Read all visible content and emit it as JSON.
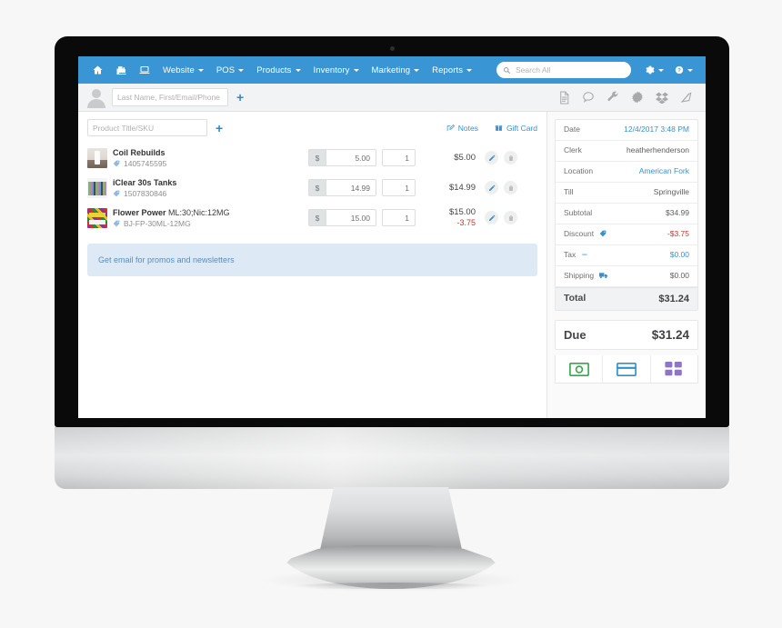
{
  "topnav": {
    "icons": [
      {
        "name": "home-icon"
      },
      {
        "name": "cash-register-icon"
      },
      {
        "name": "laptop-icon"
      }
    ],
    "menus": [
      {
        "label": "Website"
      },
      {
        "label": "POS"
      },
      {
        "label": "Products"
      },
      {
        "label": "Inventory"
      },
      {
        "label": "Marketing"
      },
      {
        "label": "Reports"
      }
    ],
    "search_placeholder": "Search All",
    "right_menus": [
      {
        "name": "settings-menu",
        "icon": "gear-icon"
      },
      {
        "name": "help-menu",
        "icon": "question-circle-icon"
      }
    ],
    "bg_color": "#3a95d4"
  },
  "customer_bar": {
    "avatar": "avatar-placeholder",
    "search_placeholder": "Last Name, First/Email/Phone",
    "add_label": "+",
    "tools": [
      {
        "name": "document-icon"
      },
      {
        "name": "comment-icon"
      },
      {
        "name": "wrench-icon"
      },
      {
        "name": "burst-gear-icon"
      },
      {
        "name": "dropbox-icon"
      },
      {
        "name": "tag-icon"
      }
    ]
  },
  "order": {
    "product_search_placeholder": "Product Title/SKU",
    "add_label": "+",
    "notes_label": "Notes",
    "gift_card_label": "Gift Card",
    "currency_symbol": "$",
    "items": [
      {
        "name": "Coil Rebuilds",
        "variant": "",
        "sku": "1405745595",
        "price": "5.00",
        "qty": "1",
        "total": "$5.00",
        "discount": ""
      },
      {
        "name": "iClear 30s Tanks",
        "variant": "",
        "sku": "1507830846",
        "price": "14.99",
        "qty": "1",
        "total": "$14.99",
        "discount": ""
      },
      {
        "name": "Flower Power",
        "variant": "ML:30;Nic:12MG",
        "sku": "BJ-FP-30ML-12MG",
        "price": "15.00",
        "qty": "1",
        "total": "$15.00",
        "discount": "-3.75"
      }
    ],
    "promo_text": "Get email for promos and newsletters"
  },
  "summary": {
    "rows": [
      {
        "label": "Date",
        "value": "12/4/2017 3:48 PM",
        "style": "link"
      },
      {
        "label": "Clerk",
        "value": "heatherhenderson",
        "style": "plain"
      },
      {
        "label": "Location",
        "value": "American Fork",
        "style": "link"
      },
      {
        "label": "Till",
        "value": "Springville",
        "style": "plain"
      },
      {
        "label": "Subtotal",
        "value": "$34.99",
        "style": "plain"
      },
      {
        "label": "Discount",
        "value": "-$3.75",
        "style": "neg",
        "icon": "percent-tag-icon"
      },
      {
        "label": "Tax",
        "value": "$0.00",
        "style": "link",
        "icon": "dash-icon"
      },
      {
        "label": "Shipping",
        "value": "$0.00",
        "style": "plain",
        "icon": "truck-icon"
      }
    ],
    "total_label": "Total",
    "total_value": "$31.24",
    "due_label": "Due",
    "due_value": "$31.24",
    "payment_buttons": [
      {
        "name": "cash-payment-button",
        "icon": "banknote-icon",
        "color": "#36a84b"
      },
      {
        "name": "card-payment-button",
        "icon": "credit-card-icon",
        "color": "#2f8fc9"
      },
      {
        "name": "other-payment-button",
        "icon": "grid-icon",
        "color": "#8e76c4"
      }
    ]
  },
  "colors": {
    "nav_blue": "#3a95d4",
    "link_blue": "#3a8fd0",
    "discount_red": "#c0392b",
    "promo_bg": "#ddeaf6"
  }
}
